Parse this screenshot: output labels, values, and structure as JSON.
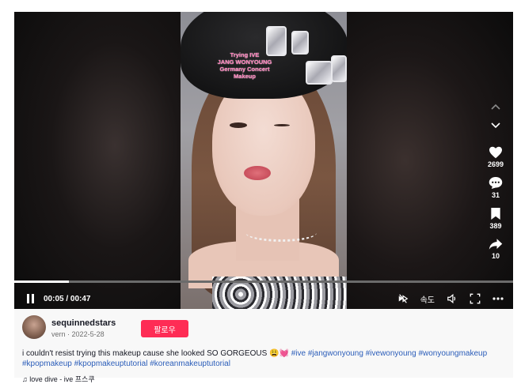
{
  "video": {
    "caption_lines": [
      "Trying IVE",
      "JANG WONYOUNG",
      "Germany Concert",
      "Makeup"
    ],
    "current_time": "00:05",
    "duration": "00:47",
    "time_sep": " / ",
    "progress": 0.11,
    "speed_label": "속도"
  },
  "actions": {
    "likes": "2699",
    "comments": "31",
    "saves": "389",
    "shares": "10"
  },
  "post": {
    "username": "sequinnedstars",
    "sub_name": "vern",
    "sub_date": "2022-5-28",
    "follow_label": "팔로우",
    "description": "i couldn't resist trying this makeup cause she looked SO GORGEOUS 😩💓",
    "hashtags": [
      "#ive",
      "#jangwonyoung",
      "#ivewonyoung",
      "#wonyoungmakeup",
      "#kpopmakeup",
      "#kpopmakeuptutorial",
      "#koreanmakeuptutorial"
    ],
    "music": "♫ love dive - ive 프스쿠"
  },
  "colors": {
    "follow_bg": "#fe2c55",
    "hashtag": "#2b5db9",
    "caption_pink": "#ff7ab8"
  }
}
